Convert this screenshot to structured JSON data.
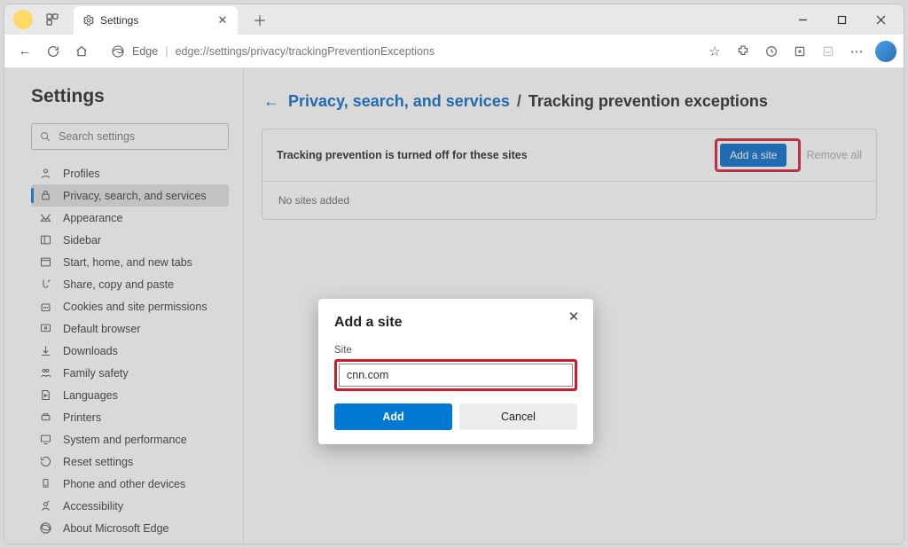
{
  "tab": {
    "title": "Settings"
  },
  "address": {
    "source": "Edge",
    "url": "edge://settings/privacy/trackingPreventionExceptions"
  },
  "sidebar": {
    "heading": "Settings",
    "search_placeholder": "Search settings",
    "items": [
      {
        "label": "Profiles"
      },
      {
        "label": "Privacy, search, and services"
      },
      {
        "label": "Appearance"
      },
      {
        "label": "Sidebar"
      },
      {
        "label": "Start, home, and new tabs"
      },
      {
        "label": "Share, copy and paste"
      },
      {
        "label": "Cookies and site permissions"
      },
      {
        "label": "Default browser"
      },
      {
        "label": "Downloads"
      },
      {
        "label": "Family safety"
      },
      {
        "label": "Languages"
      },
      {
        "label": "Printers"
      },
      {
        "label": "System and performance"
      },
      {
        "label": "Reset settings"
      },
      {
        "label": "Phone and other devices"
      },
      {
        "label": "Accessibility"
      },
      {
        "label": "About Microsoft Edge"
      }
    ]
  },
  "breadcrumb": {
    "link": "Privacy, search, and services",
    "current": "Tracking prevention exceptions"
  },
  "panel": {
    "title": "Tracking prevention is turned off for these sites",
    "add_label": "Add a site",
    "remove_all": "Remove all",
    "empty": "No sites added"
  },
  "dialog": {
    "title": "Add a site",
    "field_label": "Site",
    "value": "cnn.com",
    "add": "Add",
    "cancel": "Cancel"
  }
}
